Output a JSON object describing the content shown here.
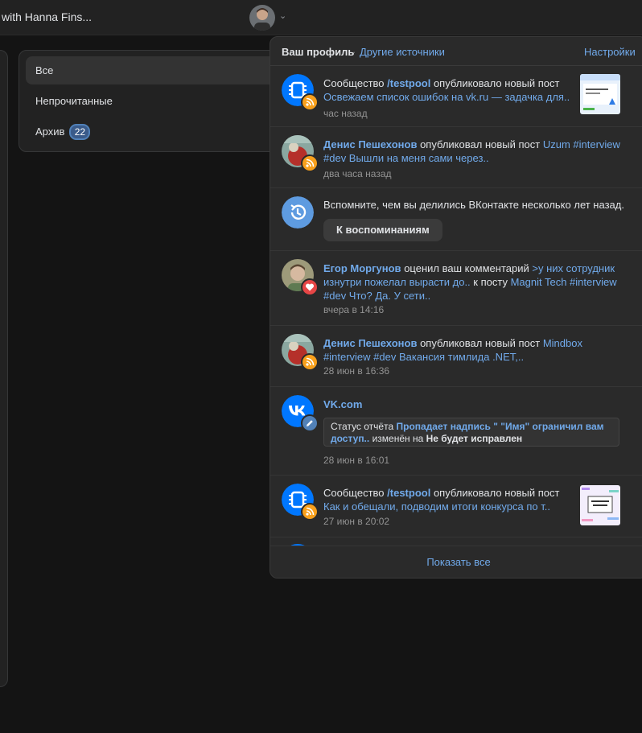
{
  "topbar": {
    "tab_title": "with Hanna Fins...",
    "chevron": "⌄"
  },
  "filters": {
    "items": [
      {
        "label": "Все"
      },
      {
        "label": "Непрочитанные"
      },
      {
        "label": "Архив"
      }
    ],
    "archive_count": "22"
  },
  "panel": {
    "title": "Ваш профиль",
    "dot": "·",
    "other_sources": "Другие источники",
    "settings": "Настройки",
    "show_all": "Показать все",
    "n1": {
      "prefix": "Сообщество",
      "group": "/testpool",
      "action": "опубликовало новый пост",
      "post": "Освежаем список ошибок на vk.ru — задачка для..",
      "time": "час назад"
    },
    "n2": {
      "user": "Денис Пешехонов",
      "action": "опубликовал новый пост",
      "post": "Uzum #interview #dev Вышли на меня сами через..",
      "time": "два часа назад"
    },
    "n3": {
      "text": "Вспомните, чем вы делились ВКонтакте несколько лет назад.",
      "button": "К воспоминаниям"
    },
    "n4": {
      "user": "Егор Моргунов",
      "action": "оценил ваш комментарий",
      "comment": ">у них сотрудник изнутри пожелал вырасти до..",
      "to_post": "к посту",
      "post": "Magnit Tech #interview #dev Что? Да. У сети..",
      "time": "вчера в 14:16"
    },
    "n5": {
      "user": "Денис Пешехонов",
      "action": "опубликовал новый пост",
      "post": "Mindbox #interview #dev Вакансия тимлида .NET,..",
      "time": "28 июн в 16:36"
    },
    "n6": {
      "source": "VK.com",
      "status_prefix": "Статус отчёта",
      "report": "Пропадает надпись \" \"Имя\" ограничил вам доступ..",
      "changed": "изменён на",
      "new_status": "Не будет исправлен",
      "time": "28 июн в 16:01"
    },
    "n7": {
      "prefix": "Сообщество",
      "group": "/testpool",
      "action": "опубликовало новый пост",
      "post": "Как и обещали, подводим итоги конкурса по т..",
      "time": "27 июн в 20:02"
    }
  },
  "colors": {
    "background": "#141414",
    "panel": "#2a2a2a",
    "link": "#71aaeb",
    "rss_badge": "#f8a01c",
    "like_badge": "#e64646",
    "vk_blue": "#0077ff"
  }
}
